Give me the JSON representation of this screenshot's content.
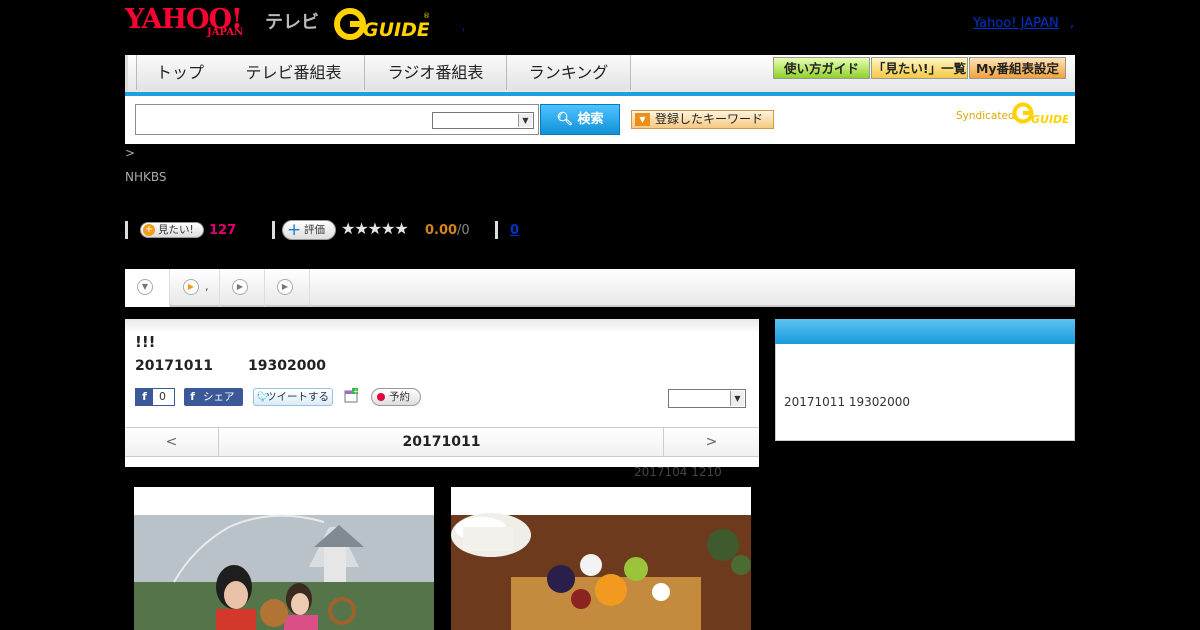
{
  "header": {
    "logo_yahoo": "YAHOO!",
    "logo_yahoo_sub": "JAPAN",
    "logo_tv": "テレビ",
    "logo_gguide": "G-GUIDE",
    "link_yahoo_japan": "Yahoo! JAPAN",
    "link_comma": ",",
    "dot": ","
  },
  "nav": {
    "tabs": [
      "トップ",
      "テレビ番組表",
      "ラジオ番組表",
      "ランキング"
    ],
    "buttons": [
      "使い方ガイド",
      "「見たい!」一覧",
      "My番組表設定"
    ]
  },
  "search": {
    "input_value": "",
    "select_value": "",
    "button_label": "検索",
    "keyword_button": "登録したキーワード",
    "syndicated_label": "Syndicated",
    "syndicated_logo": "G-GUIDE"
  },
  "breadcrumb": ">",
  "channel": "NHKBS",
  "stats": {
    "mitai_label": "見たい!",
    "mitai_count": "127",
    "hyoka_label": "評価",
    "stars": "★★★★★",
    "rating": "0.00",
    "rating_count": "/0",
    "comment_count": "0"
  },
  "tabs_row": {
    "items": [
      "",
      ",",
      "",
      ""
    ]
  },
  "program": {
    "title": "!!!",
    "date": "20171011",
    "time": "19302000",
    "fb_like_count": "0",
    "fb_share_label": "シェア",
    "tweet_label": "ツイートする",
    "yoyaku_label": "予約",
    "select_value": "",
    "nav_prev": "<",
    "nav_current": "20171011",
    "nav_next": ">",
    "update_info": "2017104  1210"
  },
  "side": {
    "header": "",
    "text": "20171011  19302000"
  },
  "colors": {
    "accent_blue": "#1f9fde",
    "yahoo_red": "#ff0033",
    "gguide_yellow": "#ffd200",
    "mitai_pink": "#e4006f",
    "rating_orange": "#d4841a"
  }
}
